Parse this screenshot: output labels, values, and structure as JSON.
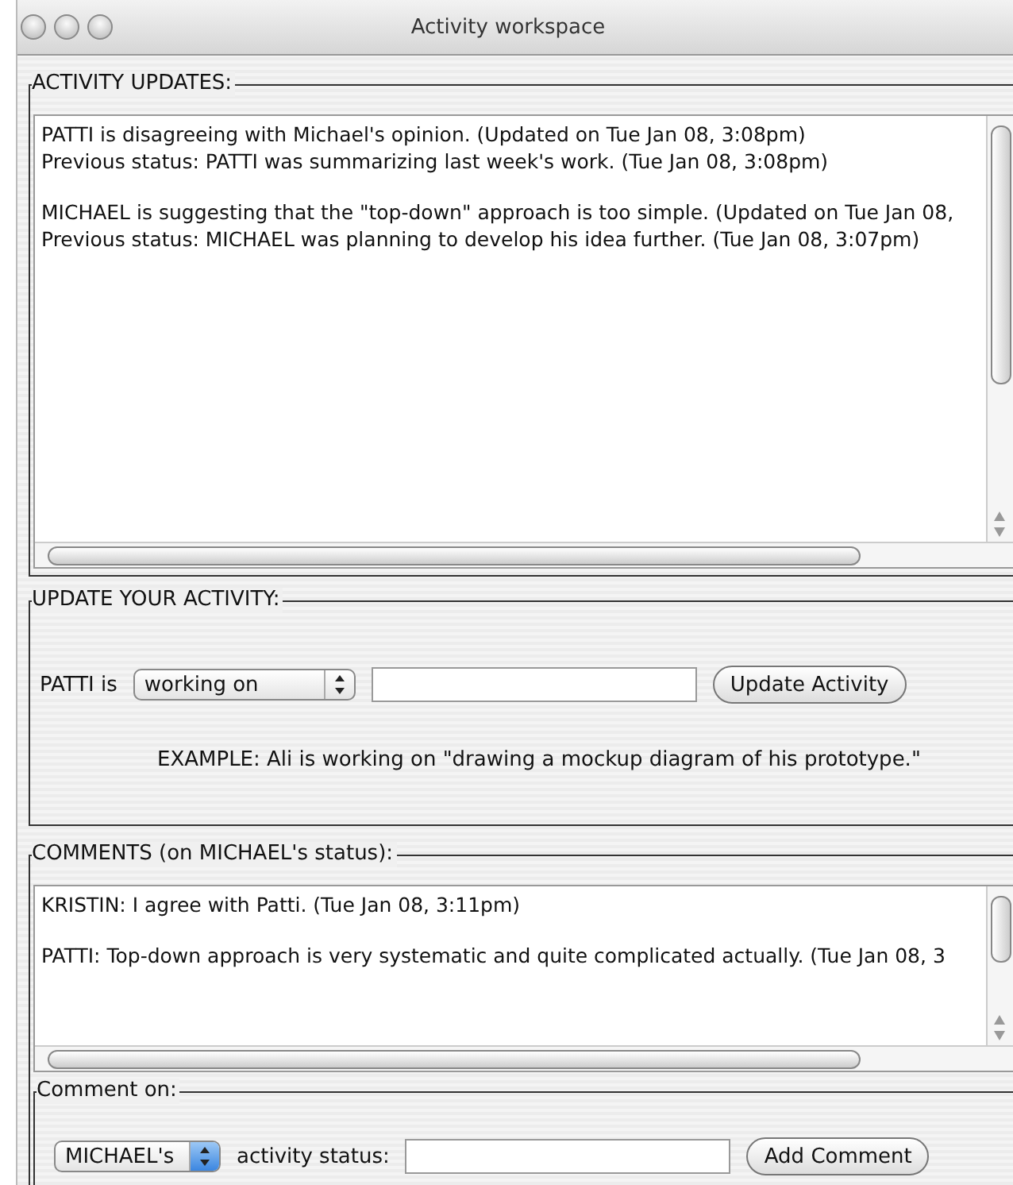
{
  "window": {
    "title": "Activity workspace"
  },
  "activity_updates": {
    "legend": "ACTIVITY UPDATES:",
    "entries": [
      {
        "lines": [
          "PATTI is disagreeing with Michael's opinion. (Updated on Tue Jan 08, 3:08pm)",
          "Previous status: PATTI was summarizing last week's work. (Tue Jan 08, 3:08pm)"
        ]
      },
      {
        "lines": [
          "MICHAEL is suggesting that the \"top-down\" approach is too simple. (Updated on Tue Jan 08,",
          "Previous status: MICHAEL was planning to develop his idea further. (Tue Jan 08, 3:07pm)"
        ]
      }
    ]
  },
  "update_activity": {
    "legend": "UPDATE YOUR ACTIVITY:",
    "subject": "PATTI is",
    "verb_select": "working on",
    "button": "Update Activity",
    "example": "EXAMPLE: Ali is working on \"drawing a mockup diagram of his prototype.\""
  },
  "comments": {
    "legend": "COMMENTS (on MICHAEL's status):",
    "entries": [
      {
        "lines": [
          "KRISTIN: I agree with Patti. (Tue Jan 08, 3:11pm)"
        ]
      },
      {
        "lines": [
          "PATTI: Top-down approach is very systematic and quite complicated actually. (Tue Jan 08, 3"
        ]
      }
    ],
    "comment_on": {
      "legend": "Comment on:",
      "target_select": "MICHAEL's",
      "label": "activity status:",
      "button": "Add Comment"
    }
  }
}
